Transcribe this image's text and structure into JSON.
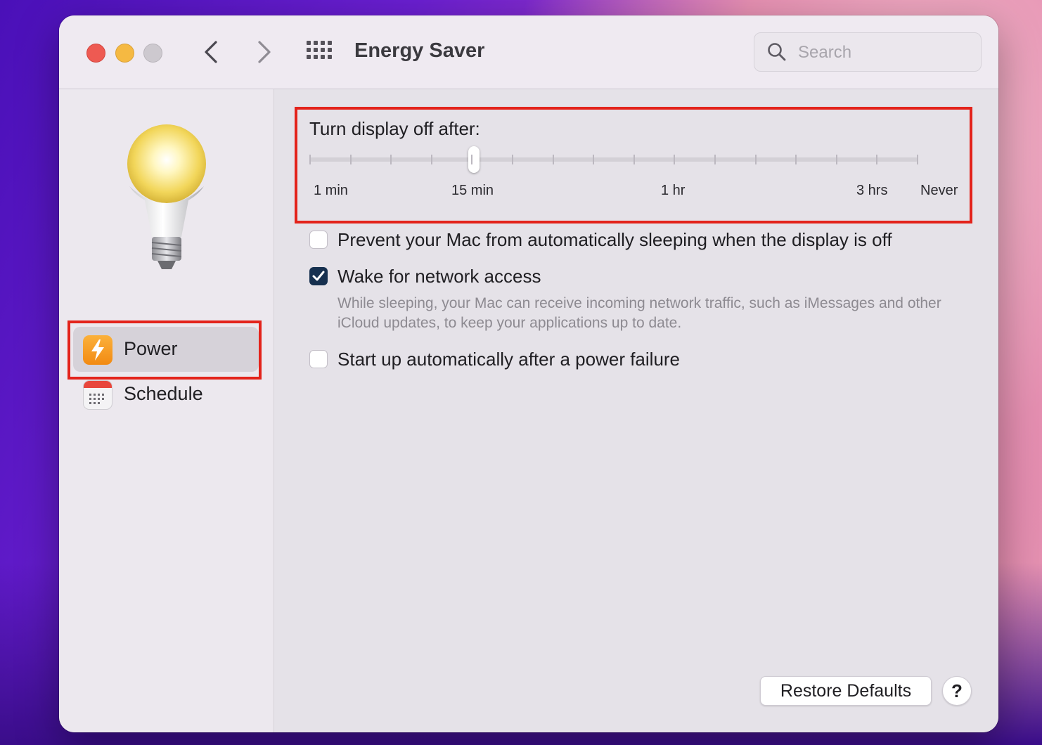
{
  "window": {
    "title": "Energy Saver",
    "search_placeholder": "Search",
    "icons": {
      "close": "red-dot",
      "minimize": "yellow-dot",
      "zoom": "gray-dot",
      "back": "chevron-left-icon",
      "forward": "chevron-right-icon",
      "grid": "grid-icon",
      "search": "search-icon"
    }
  },
  "sidebar": {
    "header_icon": "lightbulb-icon",
    "items": [
      {
        "label": "Power",
        "icon": "lightning-icon",
        "selected": true
      },
      {
        "label": "Schedule",
        "icon": "calendar-icon",
        "selected": false
      }
    ]
  },
  "display_off": {
    "label": "Turn display off after:",
    "tick_labels": [
      "1 min",
      "15 min",
      "1 hr",
      "3 hrs",
      "Never"
    ],
    "value": "15 min",
    "tick_count": 16
  },
  "options": [
    {
      "label": "Prevent your Mac from automatically sleeping when the display is off",
      "checked": false
    },
    {
      "label": "Wake for network access",
      "checked": true,
      "description": "While sleeping, your Mac can receive incoming network traffic, such as iMessages and other iCloud updates, to keep your applications up to date."
    },
    {
      "label": "Start up automatically after a power failure",
      "checked": false
    }
  ],
  "footer": {
    "restore_label": "Restore Defaults",
    "help_label": "?"
  },
  "colors": {
    "highlight": "#e3231b",
    "checkbox_checked": "#16304f",
    "power_icon": "#f59b1f"
  }
}
